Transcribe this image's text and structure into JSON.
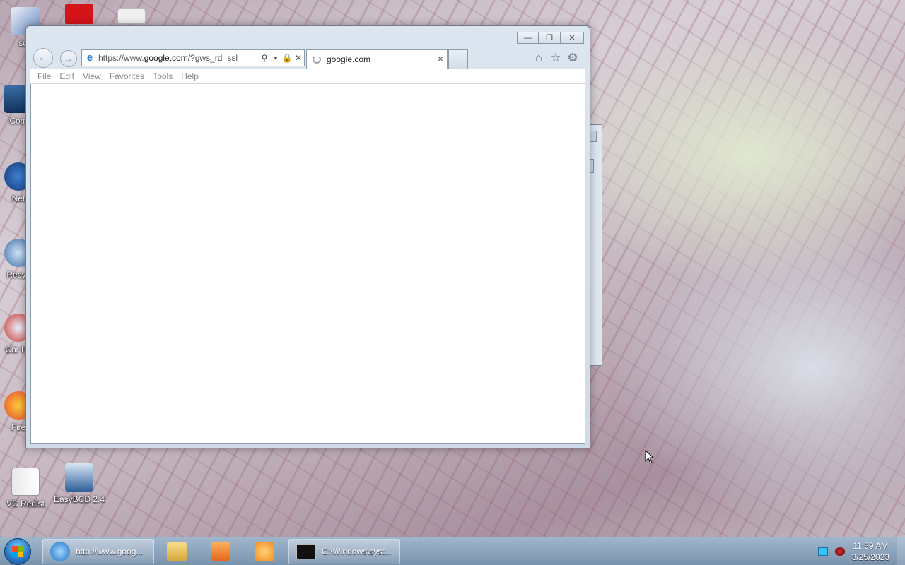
{
  "desktop": {
    "icons": [
      {
        "label": "sup",
        "name": "user-folder-icon"
      },
      {
        "label": "",
        "name": "adobe-reader-icon"
      },
      {
        "label": "",
        "name": "blank-file-icon"
      },
      {
        "label": "Com",
        "name": "computer-icon"
      },
      {
        "label": "Net",
        "name": "network-icon"
      },
      {
        "label": "Recyc",
        "name": "recycle-bin-icon"
      },
      {
        "label": "Cor Pa",
        "name": "control-panel-icon"
      },
      {
        "label": "Fire",
        "name": "firefox-icon"
      },
      {
        "label": "VC Redist",
        "name": "vc-redist-icon"
      },
      {
        "label": "EasyBCD 2.4",
        "name": "easybcd-icon"
      }
    ]
  },
  "browser": {
    "address": {
      "prefix": "https://www.",
      "host": "google.com",
      "path": "/?gws_rd=ssl"
    },
    "tab": {
      "title": "google.com"
    },
    "menu": [
      "File",
      "Edit",
      "View",
      "Favorites",
      "Tools",
      "Help"
    ]
  },
  "taskbar": {
    "items": [
      {
        "label": "http://www.goog...",
        "name": "taskbar-ie-button"
      },
      {
        "label": "C:\\Windows\\syst...",
        "name": "taskbar-cmd-button"
      }
    ],
    "clock": {
      "time": "11:59 AM",
      "date": "3/25/2023"
    }
  },
  "colors": {
    "accent": "#2a7fd4",
    "taskbar": "#8aa3bc"
  }
}
